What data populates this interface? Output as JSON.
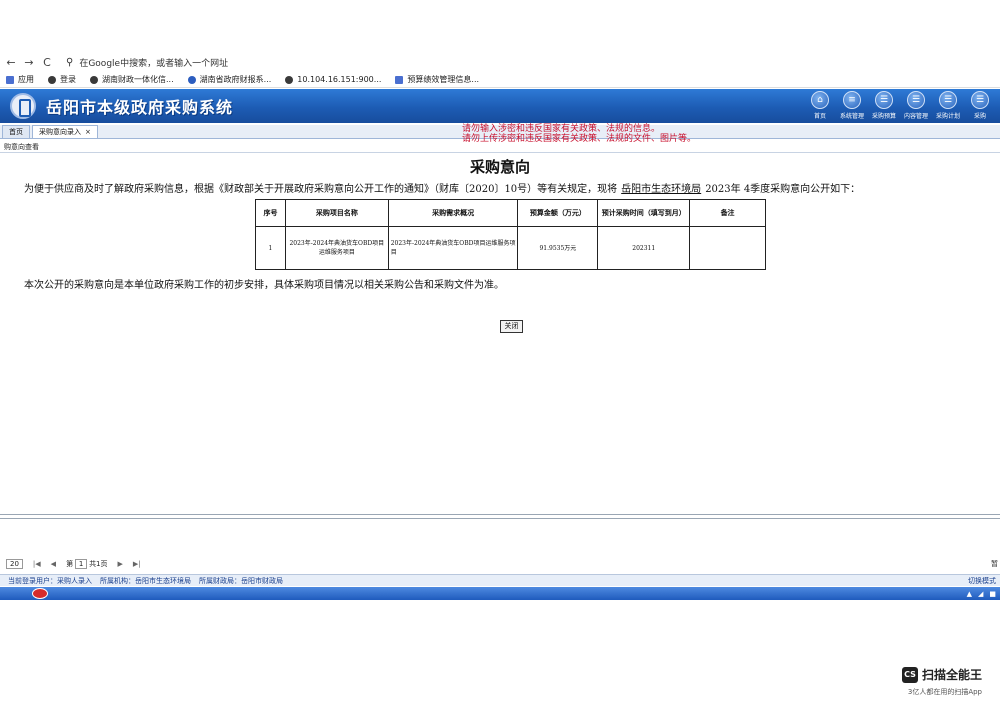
{
  "browser": {
    "back": "←",
    "forward": "→",
    "reload": "C",
    "omnibox_placeholder": "在Google中搜索，或者输入一个网址",
    "bookmarks": [
      "应用",
      "登录",
      "湖南财政一体化信...",
      "湖南省政府财报系...",
      "10.104.16.151:900...",
      "预算绩效管理信息..."
    ]
  },
  "app": {
    "title": "岳阳市本级政府采购系统",
    "header_icons": [
      {
        "label": "首页",
        "icon": "home-icon",
        "glyph": "⌂"
      },
      {
        "label": "系统管理",
        "icon": "settings-icon",
        "glyph": "≡"
      },
      {
        "label": "采购预算",
        "icon": "budget-icon",
        "glyph": "☰"
      },
      {
        "label": "内容管理",
        "icon": "content-icon",
        "glyph": "☰"
      },
      {
        "label": "采购计划",
        "icon": "plan-icon",
        "glyph": "☰"
      },
      {
        "label": "采购",
        "icon": "purchase-icon",
        "glyph": "☰"
      }
    ],
    "warnings": [
      "请勿输入涉密和违反国家有关政策、法规的信息。",
      "请勿上传涉密和违反国家有关政策、法规的文件、图片等。"
    ],
    "tabs": [
      {
        "label": "首页"
      },
      {
        "label": "采购意向录入"
      }
    ],
    "breadcrumb": "购意向查看"
  },
  "content": {
    "title": "采购意向",
    "intro_prefix": "为便于供应商及时了解政府采购信息，根据《财政部关于开展政府采购意向公开工作的通知》（财库〔2020〕10号）等有关规定，现将",
    "agency": "岳阳市生态环境局",
    "intro_suffix": "2023年 4季度采购意向公开如下：",
    "table": {
      "headers": [
        "序号",
        "采购项目名称",
        "采购需求概况",
        "预算金额（万元）",
        "预计采购时间（填写到月）",
        "备注"
      ],
      "rows": [
        [
          "1",
          "2023年-2024年典油货车OBD项目运维服务项目",
          "2023年-2024年典油货车OBD项目运维服务项目",
          "91.9535万元",
          "202311",
          ""
        ]
      ]
    },
    "note": "本次公开的采购意向是本单位政府采购工作的初步安排，具体采购项目情况以相关采购公告和采购文件为准。",
    "close_button": "关闭"
  },
  "pager": {
    "page_size": "20",
    "page_label": "第",
    "page_value": "1",
    "total_label": "共1页",
    "refresh": "暂"
  },
  "status_bar": {
    "user": "当前登录用户：采购人录入",
    "org": "所属机构：岳阳市生态环境局",
    "finance": "所属财政局：岳阳市财政局",
    "right": "切换模式"
  },
  "watermark": {
    "logo": "CS",
    "name": "扫描全能王",
    "tagline": "3亿人都在用的扫描App"
  }
}
